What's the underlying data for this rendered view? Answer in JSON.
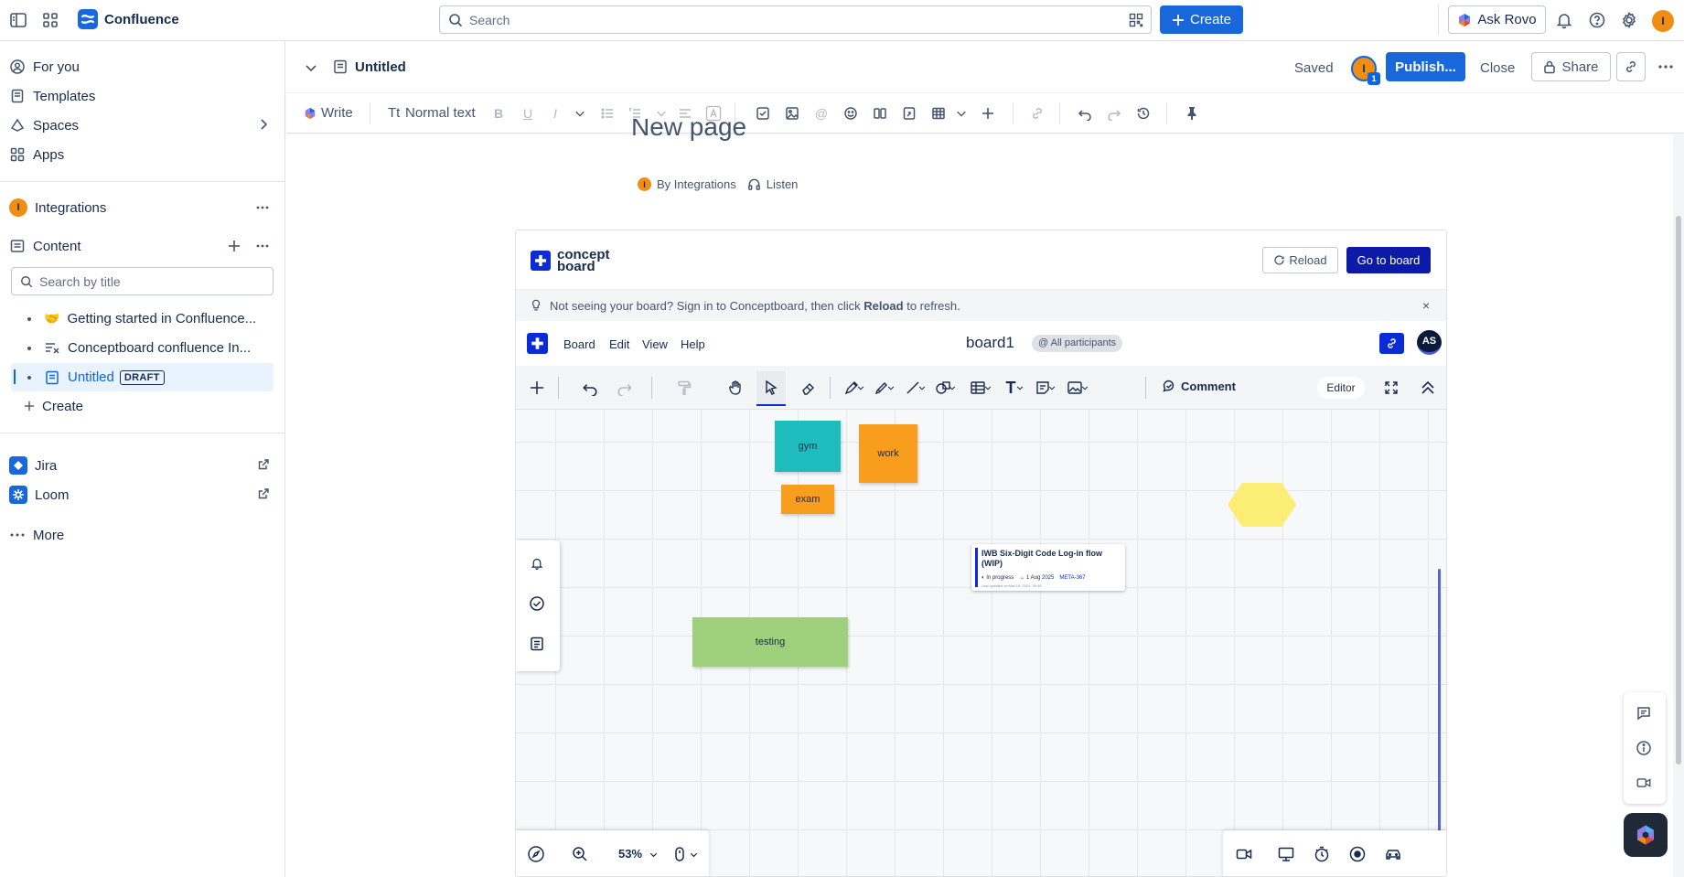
{
  "topbar": {
    "app_title": "Confluence",
    "search_placeholder": "Search",
    "create_label": "Create",
    "rovo_label": "Ask Rovo",
    "avatar_initial": "I"
  },
  "sidebar": {
    "nav": [
      {
        "label": "For you",
        "icon": "user-circle-icon"
      },
      {
        "label": "Templates",
        "icon": "templates-icon"
      },
      {
        "label": "Spaces",
        "icon": "spaces-icon"
      },
      {
        "label": "Apps",
        "icon": "apps-icon"
      }
    ],
    "space_name": "Integrations",
    "space_initial": "I",
    "content_label": "Content",
    "search_placeholder": "Search by title",
    "tree": [
      {
        "label": "Getting started in Confluence...",
        "icon": "handshake-emoji",
        "emoji": "🤝"
      },
      {
        "label": "Conceptboard confluence In...",
        "icon": "page-list-icon"
      },
      {
        "label": "Untitled",
        "icon": "page-icon",
        "badge": "DRAFT",
        "selected": true
      }
    ],
    "create_label": "Create",
    "apps": [
      {
        "label": "Jira",
        "icon": "jira-icon"
      },
      {
        "label": "Loom",
        "icon": "loom-icon"
      }
    ],
    "more_label": "More"
  },
  "page_header": {
    "title": "Untitled",
    "status": "Saved",
    "collab_initial": "I",
    "collab_badge": "1",
    "publish_label": "Publish...",
    "close_label": "Close",
    "share_label": "Share"
  },
  "toolbar": {
    "write_label": "Write",
    "text_style_label": "Normal text"
  },
  "content": {
    "page_title": "New page",
    "byline_initial": "I",
    "byline": "By Integrations",
    "listen_label": "Listen"
  },
  "conceptboard": {
    "logo_text_1": "concept",
    "logo_text_2": "board",
    "reload_label": "Reload",
    "goto_label": "Go to board",
    "notice_pre": "Not seeing your board? Sign in to Conceptboard, then click ",
    "notice_bold": "Reload",
    "notice_post": " to refresh.",
    "notice_close": "×",
    "menu": [
      "Board",
      "Edit",
      "View",
      "Help"
    ],
    "board_name": "board1",
    "participants_label": "@ All participants",
    "user_initials": "AS",
    "comment_label": "Comment",
    "editor_label": "Editor",
    "zoom_label": "53%",
    "notes": [
      {
        "label": "gym",
        "color": "#1fbcbd"
      },
      {
        "label": "work",
        "color": "#f99d1c"
      },
      {
        "label": "exam",
        "color": "#f99d1c"
      },
      {
        "label": "testing",
        "color": "#9fd07b"
      }
    ],
    "hexagon_color": "#fcee74",
    "card": {
      "title": "IWB Six-Digit Code Log-in flow (WIP)",
      "status": "In progress",
      "date": "1 Aug 2025",
      "key": "META-367",
      "updated": "Last updated on Mar 19, 2024, 09:46"
    }
  },
  "colors": {
    "brand_blue": "#1868db",
    "conceptboard_blue": "#0a2bd5",
    "avatar_orange": "#f18d13"
  }
}
